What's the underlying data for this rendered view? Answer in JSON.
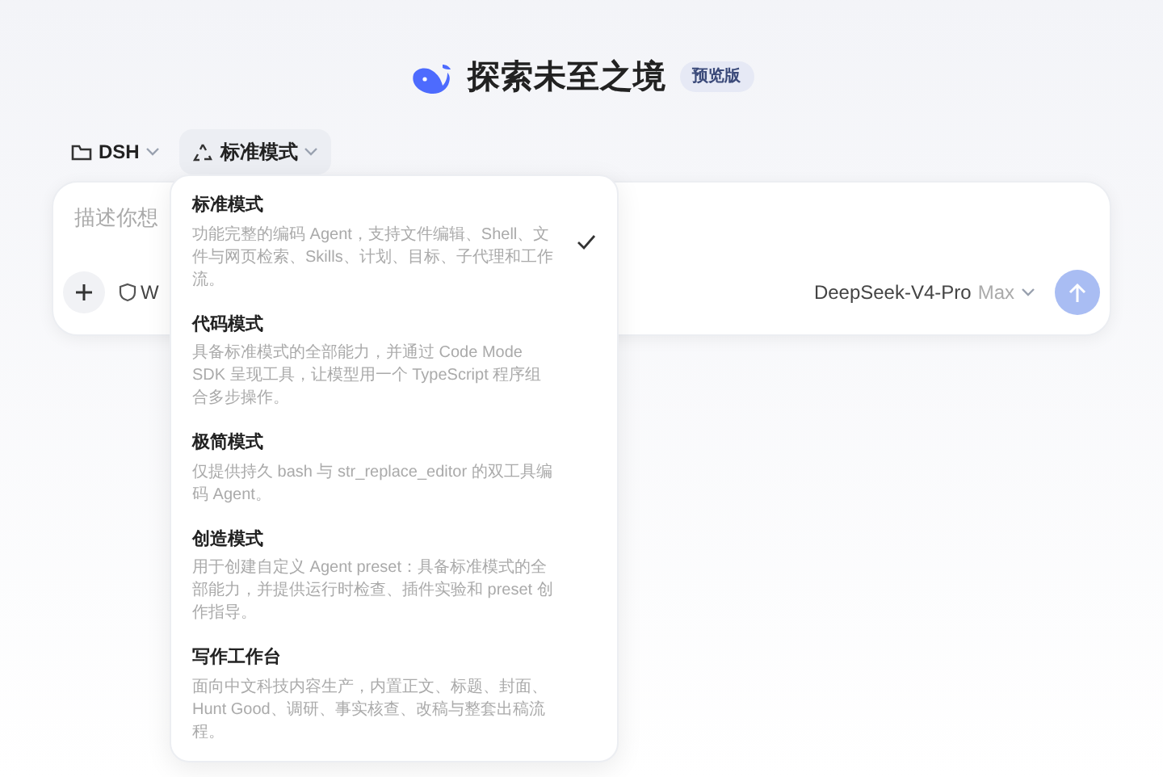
{
  "header": {
    "title": "探索未至之境",
    "badge": "预览版"
  },
  "toolbar": {
    "project": "DSH",
    "mode": "标准模式"
  },
  "composer": {
    "placeholder": "描述你想",
    "chip": "W",
    "model": "DeepSeek-V4-Pro",
    "effort": "Max"
  },
  "mode_menu": [
    {
      "title": "标准模式",
      "description": "功能完整的编码 Agent，支持文件编辑、Shell、文件与网页检索、Skills、计划、目标、子代理和工作流。",
      "selected": true
    },
    {
      "title": "代码模式",
      "description": "具备标准模式的全部能力，并通过 Code Mode SDK 呈现工具，让模型用一个 TypeScript 程序组合多步操作。",
      "selected": false
    },
    {
      "title": "极简模式",
      "description": "仅提供持久 bash 与 str_replace_editor 的双工具编码 Agent。",
      "selected": false
    },
    {
      "title": "创造模式",
      "description": "用于创建自定义 Agent preset：具备标准模式的全部能力，并提供运行时检查、插件实验和 preset 创作指导。",
      "selected": false
    },
    {
      "title": "写作工作台",
      "description": "面向中文科技内容生产，内置正文、标题、封面、Hunt Good、调研、事实核查、改稿与整套出稿流程。",
      "selected": false
    }
  ]
}
